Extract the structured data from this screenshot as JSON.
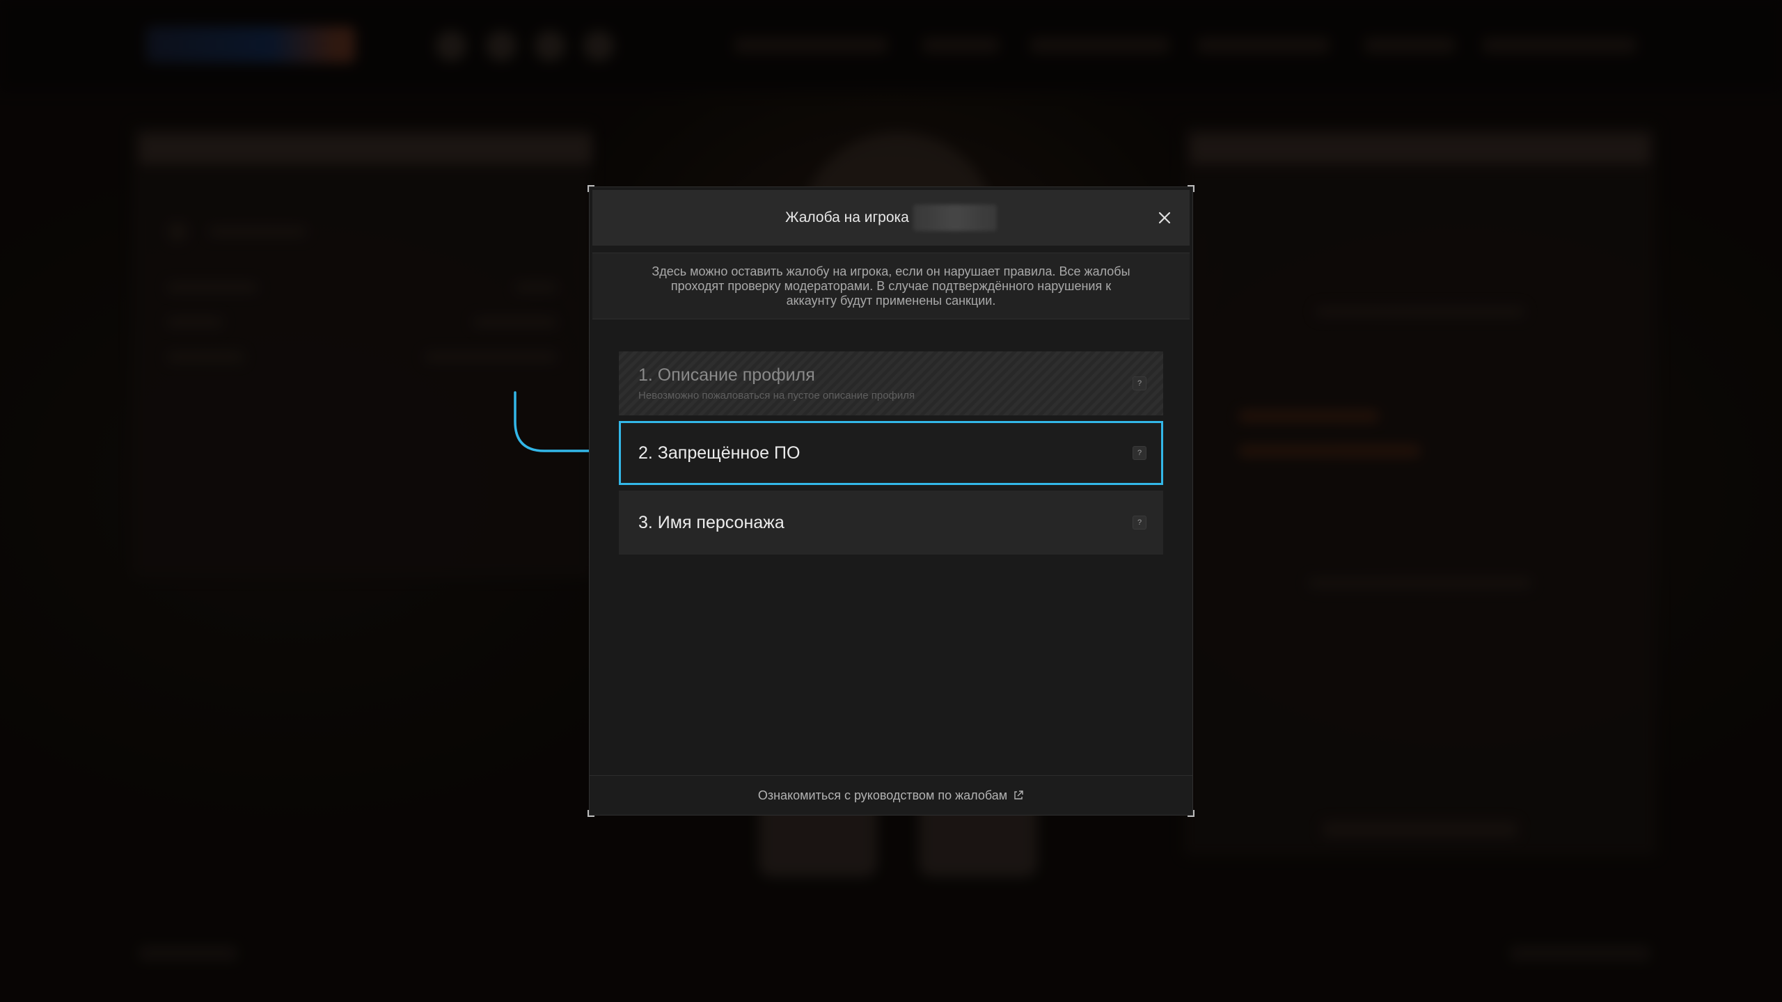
{
  "dialog": {
    "title": "Жалоба на игрока",
    "info": "Здесь можно оставить жалобу на игрока, если он нарушает правила. Все жалобы проходят проверку модераторами. В случае подтверждённого нарушения к аккаунту будут применены санкции.",
    "options": [
      {
        "label": "1. Описание профиля",
        "subtitle": "Невозможно пожаловаться на пустое описание профиля",
        "state": "disabled",
        "help": "?"
      },
      {
        "label": "2. Запрещённое ПО",
        "state": "selected",
        "help": "?"
      },
      {
        "label": "3. Имя персонажа",
        "state": "normal",
        "help": "?"
      }
    ],
    "footer_link": "Ознакомиться с руководством по жалобам"
  },
  "colors": {
    "accent": "#33b7e8",
    "modal_bg": "#1a1a1a",
    "header_bg": "#2a2a2a"
  },
  "icons": {
    "close": "close-icon",
    "help": "help-icon",
    "external": "external-link-icon",
    "annotation": "annotation-arrow-icon"
  }
}
